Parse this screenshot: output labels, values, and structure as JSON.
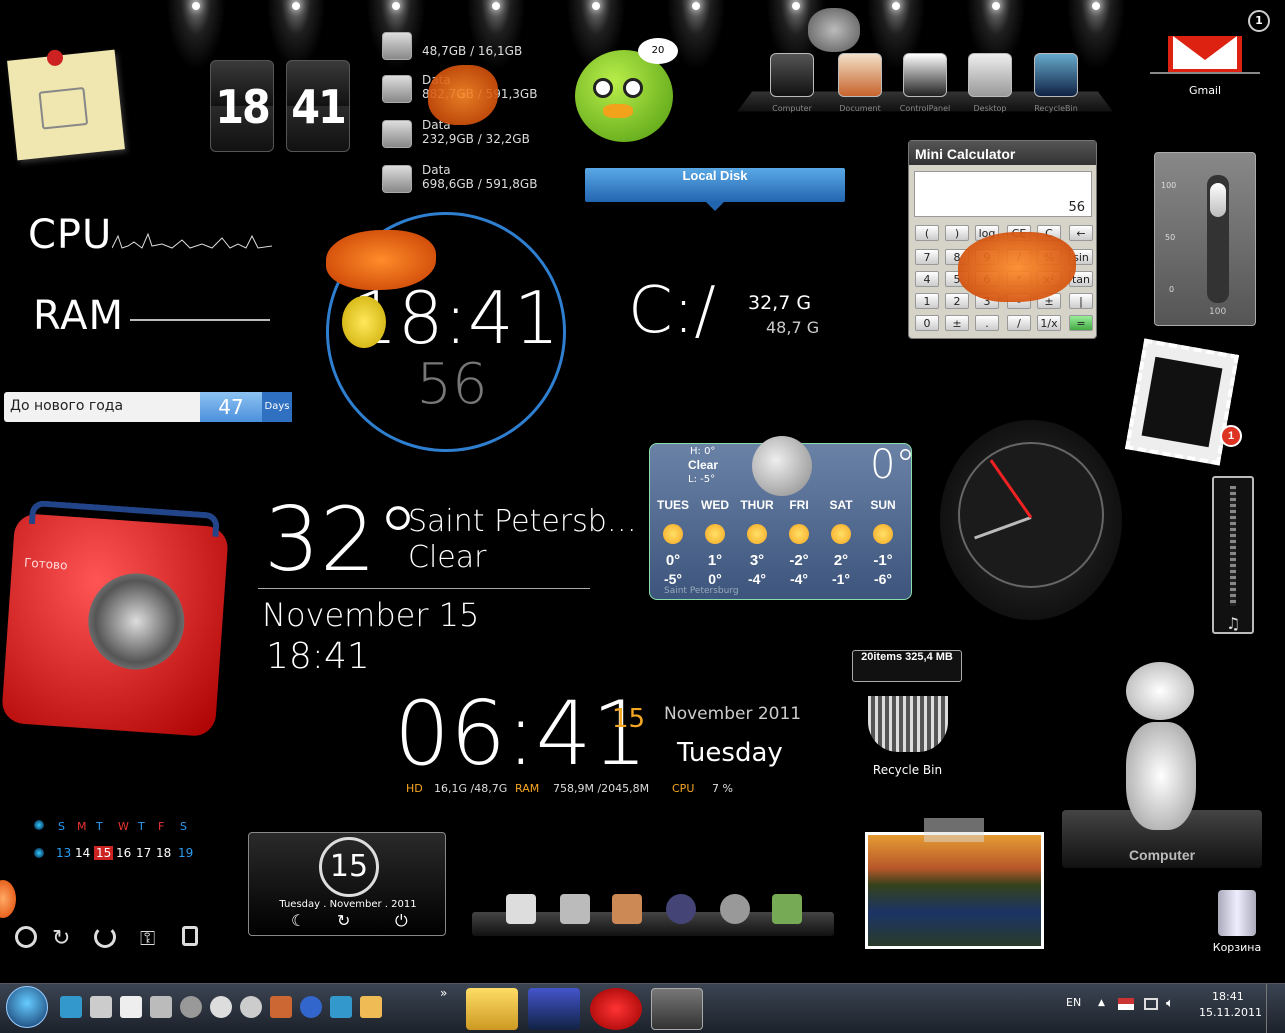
{
  "flip_clock": {
    "hour": "18",
    "minute": "41"
  },
  "disks": [
    {
      "name": "",
      "size": "48,7GB / 16,1GB"
    },
    {
      "name": "Data",
      "size": "882,7GB / 591,3GB"
    },
    {
      "name": "Data",
      "size": "232,9GB / 32,2GB"
    },
    {
      "name": "Data",
      "size": "698,6GB / 591,8GB"
    }
  ],
  "bird_badge": "20",
  "dock_top": [
    {
      "label": "Computer"
    },
    {
      "label": "Document"
    },
    {
      "label": "ControlPanel"
    },
    {
      "label": "Desktop"
    },
    {
      "label": "RecycleBin"
    }
  ],
  "gmail": {
    "label": "Gmail",
    "count": "1"
  },
  "local_disk": {
    "label": "Local Disk"
  },
  "sysmon": {
    "cpu_label": "CPU",
    "ram_label": "RAM"
  },
  "countdown": {
    "label": "До нового года",
    "value": "47",
    "unit": "Days"
  },
  "round_clock": {
    "time": "18:41",
    "seconds": "56"
  },
  "drive_c": {
    "label": "C:/",
    "free": "32,7 G",
    "total": "48,7 G"
  },
  "calculator": {
    "title": "Mini Calculator",
    "display": "56",
    "keys": [
      "(",
      ")",
      "log",
      "CE",
      "C",
      "←",
      "7",
      "8",
      "9",
      "/",
      "%",
      "sin",
      "4",
      "5",
      "6",
      "*",
      "x²",
      "tan",
      "1",
      "2",
      "3",
      "-",
      "±",
      "|",
      "0",
      "±",
      ".",
      "/",
      "1/x",
      "="
    ]
  },
  "volume": {
    "ticks": [
      "100",
      "50",
      "0"
    ],
    "bottom": "100"
  },
  "stamp_badge": "1",
  "weather_big": {
    "temp": "32°",
    "city": "Saint Petersb…",
    "cond": "Clear",
    "date": "November 15",
    "time": "18:41"
  },
  "weather_widget": {
    "hi": "H: 0°",
    "cond": "Clear",
    "lo": "L: -5°",
    "temp": "0°",
    "city": "Saint Petersburg",
    "days": [
      {
        "d": "TUES",
        "hi": "0°",
        "lo": "-5°"
      },
      {
        "d": "WED",
        "hi": "1°",
        "lo": "0°"
      },
      {
        "d": "THUR",
        "hi": "3°",
        "lo": "-4°"
      },
      {
        "d": "FRI",
        "hi": "-2°",
        "lo": "-4°"
      },
      {
        "d": "SAT",
        "hi": "2°",
        "lo": "-1°"
      },
      {
        "d": "SUN",
        "hi": "-1°",
        "lo": "-6°"
      }
    ]
  },
  "radio": {
    "label": "Готово"
  },
  "digital_clock": {
    "time": "06:41",
    "day": "15",
    "month_year": "November 2011",
    "weekday": "Tuesday",
    "hd_label": "HD",
    "hd_val": "16,1G /48,7G",
    "ram_label": "RAM",
    "ram_val": "758,9M /2045,8M",
    "cpu_label": "CPU",
    "cpu_val": "7 %"
  },
  "recycle": {
    "tooltip": "20items 325,4 MB",
    "label": "Recycle Bin"
  },
  "robot": {
    "label": "Computer"
  },
  "mini_cal": {
    "days": [
      "S",
      "M",
      "T",
      "W",
      "T",
      "F",
      "S"
    ],
    "dates": [
      "13",
      "14",
      "15",
      "16",
      "17",
      "18",
      "19"
    ]
  },
  "date_widget": {
    "day": "15",
    "text": "Tuesday . November . 2011"
  },
  "trash": {
    "label": "Корзина"
  },
  "taskbar": {
    "lang": "EN",
    "time": "18:41",
    "date": "15.11.2011",
    "more": "»"
  },
  "colors": {
    "accent_orange": "#f5a623",
    "accent_blue": "#2f7fd1",
    "calc_bg": "#d6d3c9",
    "weather_bg": "#4e6891"
  }
}
